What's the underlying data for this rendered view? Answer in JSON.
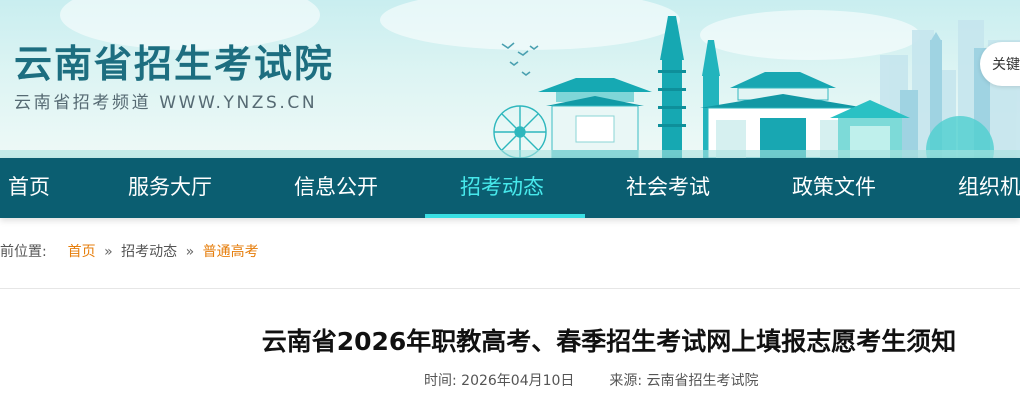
{
  "header": {
    "site_title": "云南省招生考试院",
    "site_subtitle": "云南省招考频道 WWW.YNZS.CN",
    "search_placeholder": "关键"
  },
  "nav": {
    "items": [
      {
        "label": "首页"
      },
      {
        "label": "服务大厅"
      },
      {
        "label": "信息公开"
      },
      {
        "label": "招考动态",
        "active": true
      },
      {
        "label": "社会考试"
      },
      {
        "label": "政策文件"
      },
      {
        "label": "组织机"
      }
    ]
  },
  "breadcrumb": {
    "prefix": "前位置:",
    "items": [
      "首页",
      "招考动态",
      "普通高考"
    ],
    "separator": "»"
  },
  "article": {
    "title": "云南省2026年职教高考、春季招生考试网上填报志愿考生须知",
    "time_label": "时间:",
    "time_value": "2026年04月10日",
    "source_label": "来源:",
    "source_value": "云南省招生考试院"
  },
  "colors": {
    "nav_bg": "#0b5e71",
    "nav_active": "#47e9ec",
    "title_color": "#1d6e80",
    "breadcrumb_link": "#e67e0c"
  }
}
